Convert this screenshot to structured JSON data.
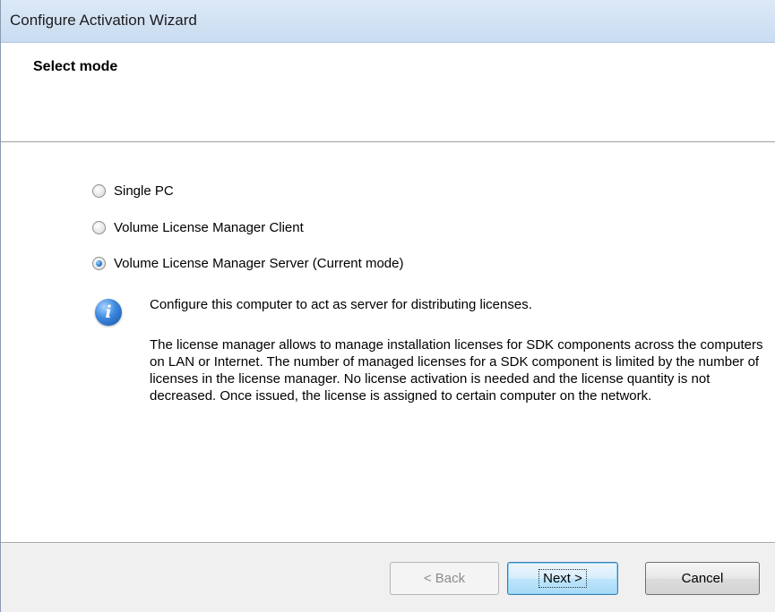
{
  "window": {
    "title": "Configure Activation Wizard"
  },
  "header": {
    "heading": "Select mode"
  },
  "modes": [
    {
      "label": "Single PC",
      "checked": false
    },
    {
      "label": "Volume License Manager Client",
      "checked": false
    },
    {
      "label": "Volume License Manager Server (Current mode)",
      "checked": true
    }
  ],
  "info": {
    "icon": "info-icon",
    "title": "Configure this computer to act as server for distributing licenses.",
    "body": "The license manager allows to manage installation licenses for SDK components across the computers on LAN or Internet. The number of managed licenses for a SDK component is limited by the number of licenses in the license manager. No license activation is needed and the license quantity is not decreased. Once issued, the license is assigned to certain computer on the network."
  },
  "buttons": {
    "back": "< Back",
    "next": "Next >",
    "cancel": "Cancel"
  }
}
